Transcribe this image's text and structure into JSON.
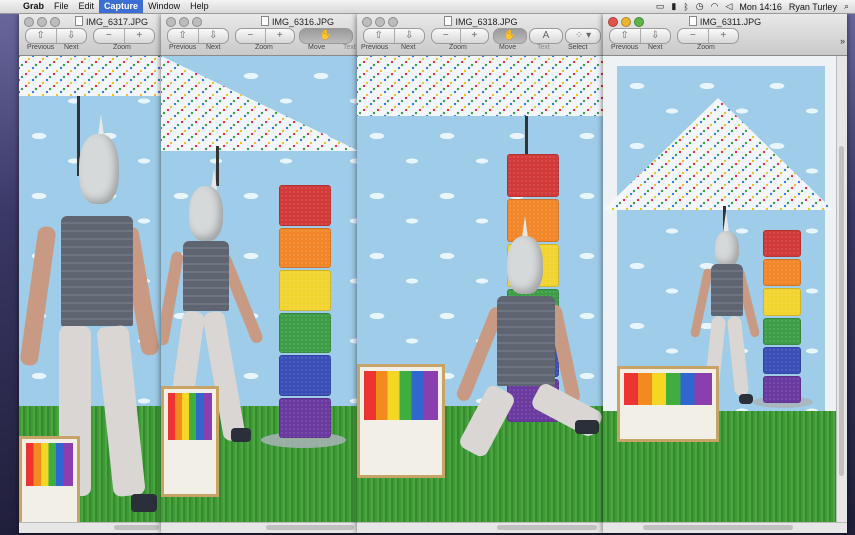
{
  "menubar": {
    "apple_icon": "apple-icon",
    "app_name": "Grab",
    "items": [
      "File",
      "Edit",
      "Capture",
      "Window",
      "Help"
    ],
    "active_item": "Capture",
    "clock": "Mon 14:16",
    "user": "Ryan Turley",
    "status_icons": [
      "display-icon",
      "battery-icon",
      "bluetooth-icon",
      "time-machine-icon",
      "wifi-icon",
      "volume-icon",
      "spotlight-icon"
    ]
  },
  "windows": [
    {
      "title": "IMG_6317.JPG",
      "labels": {
        "previous": "Previous",
        "next": "Next",
        "zoom": "Zoom"
      }
    },
    {
      "title": "IMG_6316.JPG",
      "labels": {
        "previous": "Previous",
        "next": "Next",
        "zoom": "Zoom",
        "move": "Move",
        "text": "Text"
      }
    },
    {
      "title": "IMG_6318.JPG",
      "labels": {
        "previous": "Previous",
        "next": "Next",
        "zoom": "Zoom",
        "move": "Move",
        "text": "Text",
        "select": "Select"
      }
    },
    {
      "title": "IMG_6311.JPG",
      "labels": {
        "previous": "Previous",
        "next": "Next",
        "zoom": "Zoom"
      },
      "overflow_icon": "»"
    }
  ],
  "colors": {
    "menu_highlight": "#3b6fd6",
    "backdrop": "#9fcde9",
    "grass": "#4aa83f",
    "tower": [
      "#d23a3a",
      "#f2872a",
      "#f2d430",
      "#3e9e48",
      "#3a4fb8",
      "#6a3aa0"
    ]
  }
}
